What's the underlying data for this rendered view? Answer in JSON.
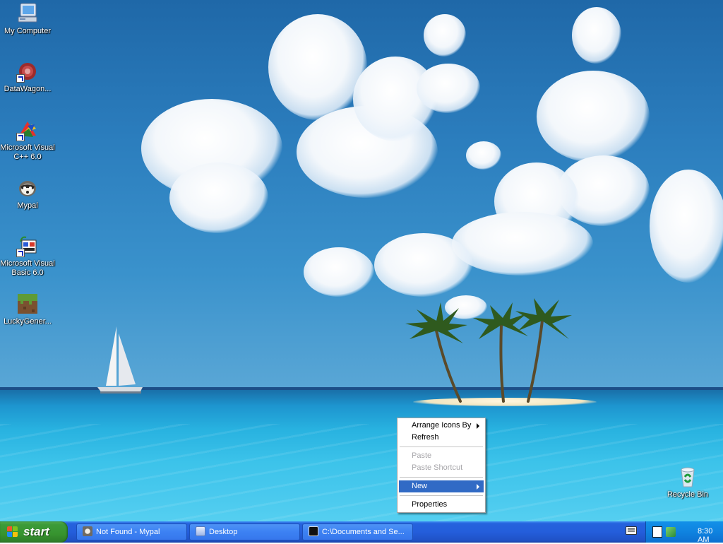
{
  "desktop": {
    "icons": [
      {
        "label": "My Computer",
        "icon": "my-computer-icon"
      },
      {
        "label": "DataWagon...",
        "icon": "datawagon-icon"
      },
      {
        "label": "Microsoft Visual C++ 6.0",
        "icon": "visual-cpp-icon"
      },
      {
        "label": "Mypal",
        "icon": "mypal-icon"
      },
      {
        "label": "Microsoft Visual Basic 6.0",
        "icon": "visual-basic-icon"
      },
      {
        "label": "LuckyGener...",
        "icon": "minecraft-block-icon"
      },
      {
        "label": "Recycle Bin",
        "icon": "recycle-bin-icon"
      }
    ]
  },
  "context_menu": {
    "arrange_icons_by": "Arrange Icons By",
    "refresh": "Refresh",
    "paste": "Paste",
    "paste_shortcut": "Paste Shortcut",
    "new": "New",
    "properties": "Properties"
  },
  "taskbar": {
    "start_label": "start",
    "tasks": [
      {
        "label": "Not Found - Mypal",
        "icon": "mypal-icon"
      },
      {
        "label": "Desktop",
        "icon": "folder-icon"
      },
      {
        "label": "C:\\Documents and Se...",
        "icon": "7zip-icon"
      }
    ],
    "tray": {
      "clock": "8:30 AM",
      "icons": [
        "keyboard-icon",
        "hfs-icon",
        "network-icon"
      ]
    }
  },
  "colors": {
    "menu_highlight": "#316ac5",
    "taskbar_blue": "#245edb",
    "start_green": "#37942f",
    "tray_blue": "#0f83e0"
  }
}
